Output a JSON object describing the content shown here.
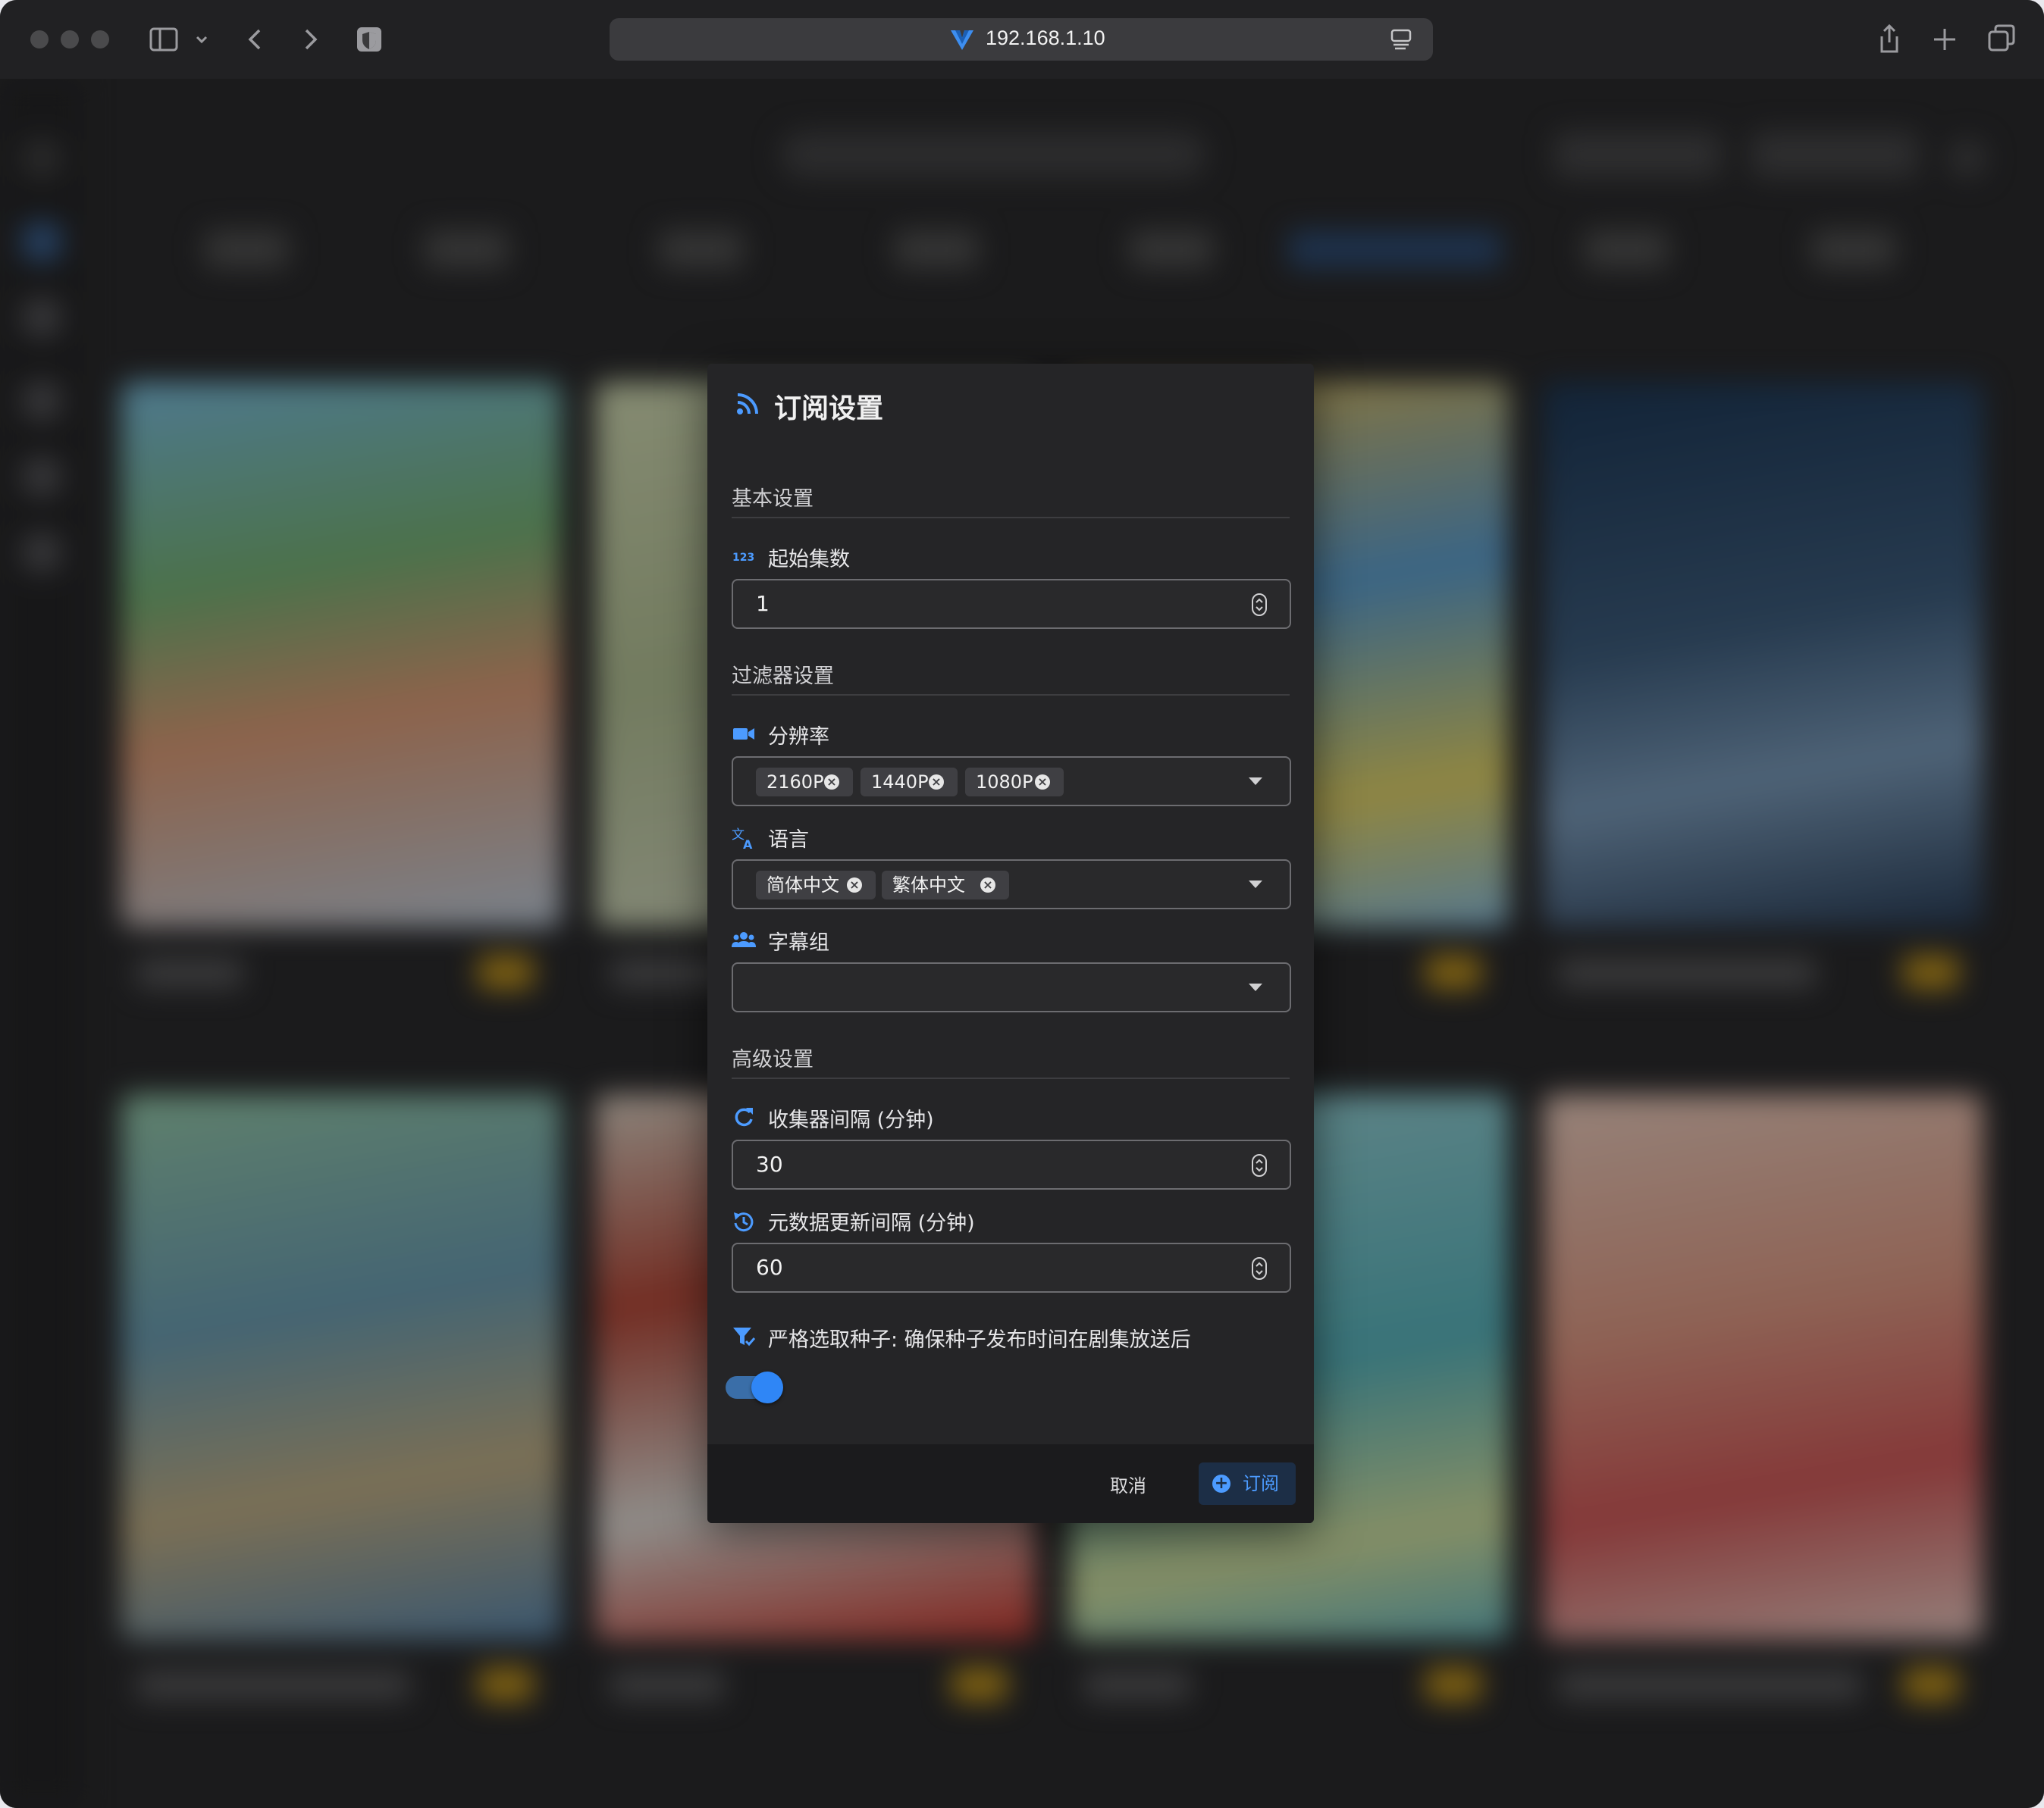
{
  "browser": {
    "url": "192.168.1.10"
  },
  "dialog": {
    "title": "订阅设置",
    "sections": {
      "basic": "基本设置",
      "filter": "过滤器设置",
      "advanced": "高级设置"
    },
    "start_episode": {
      "label": "起始集数",
      "value": "1",
      "icon": "numeric-123-icon"
    },
    "resolution": {
      "label": "分辨率",
      "chips": [
        "2160P",
        "1440P",
        "1080P"
      ],
      "icon": "video-camera-icon"
    },
    "language": {
      "label": "语言",
      "chips": [
        "简体中文",
        "繁体中文"
      ],
      "icon": "translate-icon"
    },
    "subtitle_group": {
      "label": "字幕组",
      "value": "",
      "icon": "people-group-icon"
    },
    "collector_interval": {
      "label": "收集器间隔 (分钟)",
      "value": "30",
      "icon": "refresh-icon"
    },
    "metadata_interval": {
      "label": "元数据更新间隔 (分钟)",
      "value": "60",
      "icon": "history-refresh-icon"
    },
    "strict": {
      "label": "严格选取种子: 确保种子发布时间在剧集放送后",
      "enabled": true,
      "icon": "filter-check-icon"
    },
    "buttons": {
      "cancel": "取消",
      "subscribe": "订阅"
    }
  },
  "colors": {
    "accent": "#2f86f6",
    "dialog_bg": "#252527",
    "badge": "#c99a1e"
  }
}
